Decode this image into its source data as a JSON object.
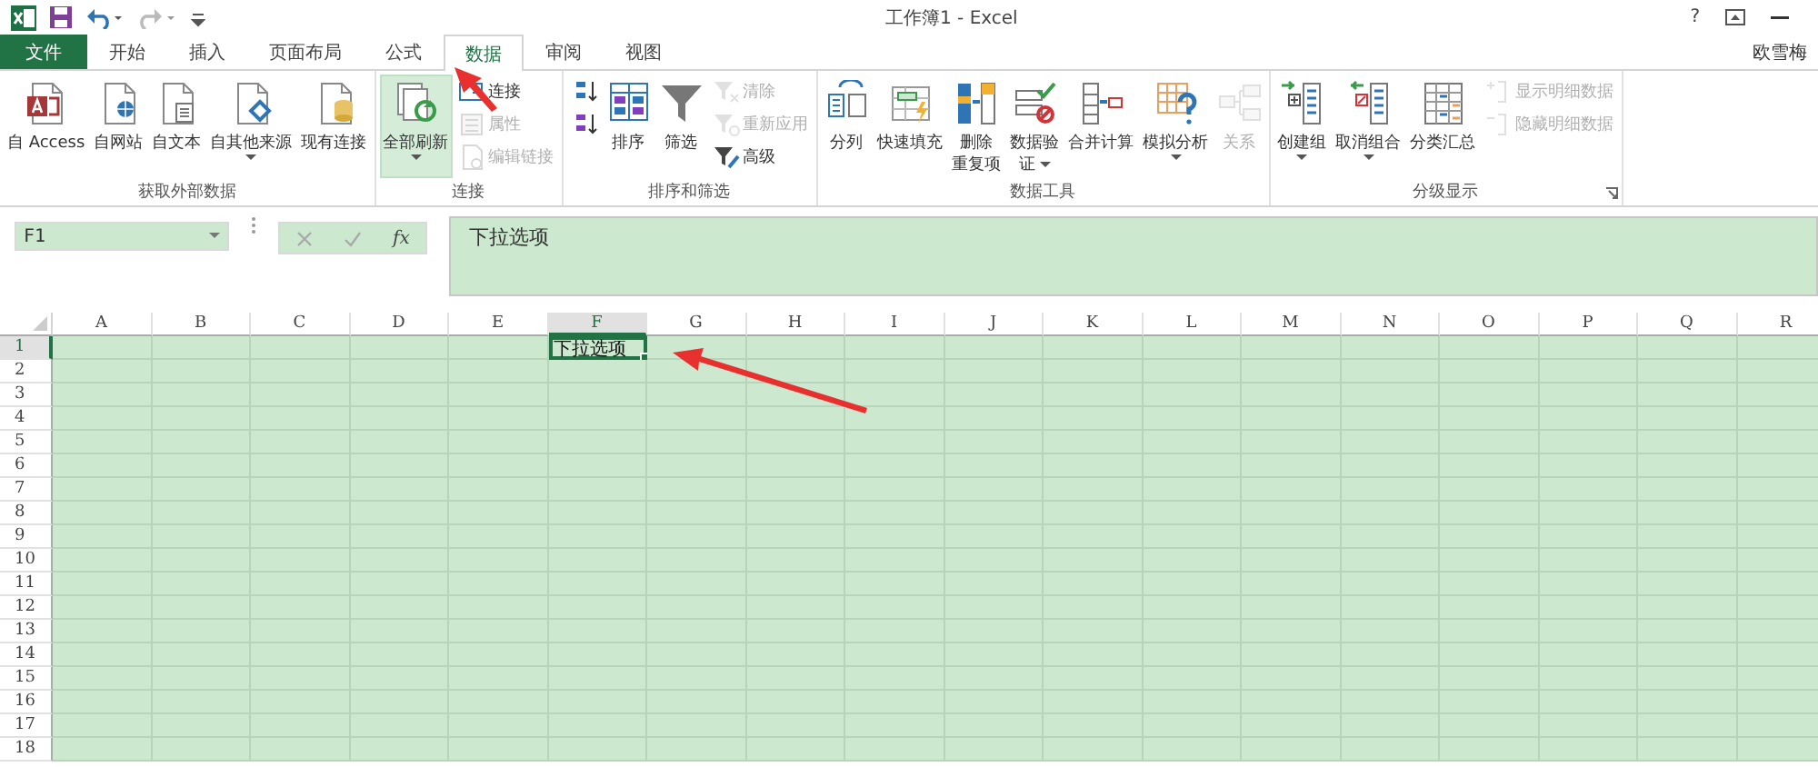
{
  "title_bar": {
    "title": "工作簿1 - Excel",
    "help": "?",
    "user": "欧雪梅"
  },
  "tabs": [
    {
      "label": "文件",
      "kind": "file",
      "selected": false
    },
    {
      "label": "开始",
      "kind": "tab",
      "selected": false
    },
    {
      "label": "插入",
      "kind": "tab",
      "selected": false
    },
    {
      "label": "页面布局",
      "kind": "tab",
      "selected": false
    },
    {
      "label": "公式",
      "kind": "tab",
      "selected": false
    },
    {
      "label": "数据",
      "kind": "tab",
      "selected": true
    },
    {
      "label": "审阅",
      "kind": "tab",
      "selected": false
    },
    {
      "label": "视图",
      "kind": "tab",
      "selected": false
    }
  ],
  "ribbon": {
    "groups": [
      {
        "label": "获取外部数据",
        "items": [
          {
            "kind": "large",
            "lines": [
              "自 Access"
            ],
            "dropdown": false,
            "disabled": false
          },
          {
            "kind": "large",
            "lines": [
              "自网站"
            ],
            "dropdown": false,
            "disabled": false
          },
          {
            "kind": "large",
            "lines": [
              "自文本"
            ],
            "dropdown": false,
            "disabled": false
          },
          {
            "kind": "large",
            "lines": [
              "自其他来源"
            ],
            "dropdown": true,
            "disabled": false
          },
          {
            "kind": "large",
            "lines": [
              "现有连接"
            ],
            "dropdown": false,
            "disabled": false
          }
        ]
      },
      {
        "label": "连接",
        "items": [
          {
            "kind": "large",
            "lines": [
              "全部刷新"
            ],
            "dropdown": true,
            "disabled": false
          },
          {
            "kind": "small",
            "lines": [
              "连接"
            ],
            "disabled": false
          },
          {
            "kind": "small",
            "lines": [
              "属性"
            ],
            "disabled": true
          },
          {
            "kind": "small",
            "lines": [
              "编辑链接"
            ],
            "disabled": true
          }
        ]
      },
      {
        "label": "排序和筛选",
        "items": [
          {
            "kind": "small",
            "disabled": false
          },
          {
            "kind": "small",
            "disabled": false
          },
          {
            "kind": "large",
            "lines": [
              "排序"
            ],
            "dropdown": false,
            "disabled": false
          },
          {
            "kind": "large",
            "lines": [
              "筛选"
            ],
            "dropdown": false,
            "disabled": false
          },
          {
            "kind": "small",
            "lines": [
              "清除"
            ],
            "disabled": true
          },
          {
            "kind": "small",
            "lines": [
              "重新应用"
            ],
            "disabled": true
          },
          {
            "kind": "small",
            "lines": [
              "高级"
            ],
            "disabled": false
          }
        ]
      },
      {
        "label": "数据工具",
        "items": [
          {
            "kind": "large",
            "lines": [
              "分列"
            ],
            "dropdown": false,
            "disabled": false
          },
          {
            "kind": "large",
            "lines": [
              "快速填充"
            ],
            "dropdown": false,
            "disabled": false
          },
          {
            "kind": "large",
            "lines": [
              "删除",
              "重复项"
            ],
            "dropdown": false,
            "disabled": false
          },
          {
            "kind": "large",
            "lines": [
              "数据验",
              "证"
            ],
            "dropdown": true,
            "disabled": false
          },
          {
            "kind": "large",
            "lines": [
              "合并计算"
            ],
            "dropdown": false,
            "disabled": false
          },
          {
            "kind": "large",
            "lines": [
              "模拟分析"
            ],
            "dropdown": true,
            "disabled": false
          },
          {
            "kind": "large",
            "lines": [
              "关系"
            ],
            "dropdown": false,
            "disabled": true
          }
        ]
      },
      {
        "label": "分级显示",
        "launcher": true,
        "items": [
          {
            "kind": "large",
            "lines": [
              "创建组"
            ],
            "dropdown": true,
            "disabled": false
          },
          {
            "kind": "large",
            "lines": [
              "取消组合"
            ],
            "dropdown": true,
            "disabled": false
          },
          {
            "kind": "large",
            "lines": [
              "分类汇总"
            ],
            "dropdown": false,
            "disabled": false
          },
          {
            "kind": "small",
            "lines": [
              "显示明细数据"
            ],
            "disabled": true
          },
          {
            "kind": "small",
            "lines": [
              "隐藏明细数据"
            ],
            "disabled": true
          }
        ]
      }
    ]
  },
  "formula_bar": {
    "name_box": "F1",
    "function_label": "fx",
    "content": "下拉选项"
  },
  "sheet": {
    "columns": [
      {
        "label": "A",
        "selected": false
      },
      {
        "label": "B",
        "selected": false
      },
      {
        "label": "C",
        "selected": false
      },
      {
        "label": "D",
        "selected": false
      },
      {
        "label": "E",
        "selected": false
      },
      {
        "label": "F",
        "selected": true
      },
      {
        "label": "G",
        "selected": false
      },
      {
        "label": "H",
        "selected": false
      },
      {
        "label": "I",
        "selected": false
      },
      {
        "label": "J",
        "selected": false
      },
      {
        "label": "K",
        "selected": false
      },
      {
        "label": "L",
        "selected": false
      },
      {
        "label": "M",
        "selected": false
      },
      {
        "label": "N",
        "selected": false
      },
      {
        "label": "O",
        "selected": false
      },
      {
        "label": "P",
        "selected": false
      },
      {
        "label": "Q",
        "selected": false
      },
      {
        "label": "R",
        "selected": false
      }
    ],
    "rows": [
      {
        "label": "1",
        "selected": true,
        "cells": [
          {
            "text": "",
            "selected": false
          },
          {
            "text": "",
            "selected": false
          },
          {
            "text": "",
            "selected": false
          },
          {
            "text": "",
            "selected": false
          },
          {
            "text": "",
            "selected": false
          },
          {
            "text": "下拉选项",
            "selected": true
          }
        ]
      },
      {
        "label": "2",
        "selected": false
      },
      {
        "label": "3",
        "selected": false
      },
      {
        "label": "4",
        "selected": false
      },
      {
        "label": "5",
        "selected": false
      },
      {
        "label": "6",
        "selected": false
      },
      {
        "label": "7",
        "selected": false
      },
      {
        "label": "8",
        "selected": false
      },
      {
        "label": "9",
        "selected": false
      },
      {
        "label": "10",
        "selected": false
      },
      {
        "label": "11",
        "selected": false
      },
      {
        "label": "12",
        "selected": false
      },
      {
        "label": "13",
        "selected": false
      },
      {
        "label": "14",
        "selected": false
      },
      {
        "label": "15",
        "selected": false
      },
      {
        "label": "16",
        "selected": false
      },
      {
        "label": "17",
        "selected": false
      },
      {
        "label": "18",
        "selected": false
      }
    ]
  }
}
